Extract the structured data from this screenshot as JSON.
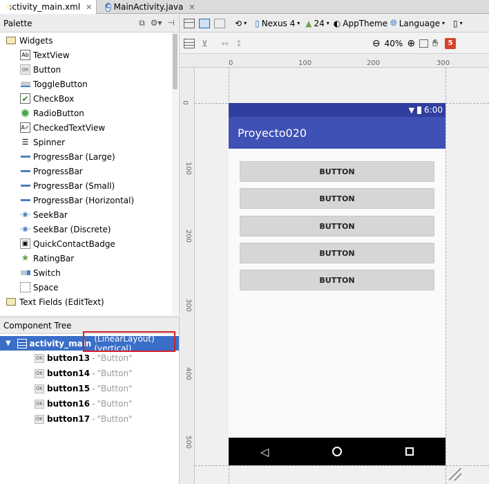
{
  "tabs": [
    {
      "label": "activity_main.xml",
      "icon": "xml-layout-icon",
      "active": true
    },
    {
      "label": "MainActivity.java",
      "icon": "java-class-icon",
      "active": false
    }
  ],
  "palette": {
    "title": "Palette",
    "items": [
      {
        "label": "Widgets",
        "kind": "folder"
      },
      {
        "label": "TextView",
        "icon": "Ab"
      },
      {
        "label": "Button",
        "icon": "OK"
      },
      {
        "label": "ToggleButton",
        "icon": "toggle"
      },
      {
        "label": "CheckBox",
        "icon": "check"
      },
      {
        "label": "RadioButton",
        "icon": "radio"
      },
      {
        "label": "CheckedTextView",
        "icon": "checked-text"
      },
      {
        "label": "Spinner",
        "icon": "spinner"
      },
      {
        "label": "ProgressBar (Large)",
        "icon": "progress"
      },
      {
        "label": "ProgressBar",
        "icon": "progress"
      },
      {
        "label": "ProgressBar (Small)",
        "icon": "progress"
      },
      {
        "label": "ProgressBar (Horizontal)",
        "icon": "progress"
      },
      {
        "label": "SeekBar",
        "icon": "seek"
      },
      {
        "label": "SeekBar (Discrete)",
        "icon": "seek"
      },
      {
        "label": "QuickContactBadge",
        "icon": "badge"
      },
      {
        "label": "RatingBar",
        "icon": "star"
      },
      {
        "label": "Switch",
        "icon": "switch"
      },
      {
        "label": "Space",
        "icon": "space"
      },
      {
        "label": "Text Fields (EditText)",
        "kind": "folder"
      }
    ]
  },
  "component_tree": {
    "title": "Component Tree",
    "root": {
      "name": "activity_main",
      "detail": "(LinearLayout) (vertical)"
    },
    "children": [
      {
        "name": "button13",
        "sep": "-",
        "text": "\"Button\""
      },
      {
        "name": "button14",
        "sep": "-",
        "text": "\"Button\""
      },
      {
        "name": "button15",
        "sep": "-",
        "text": "\"Button\""
      },
      {
        "name": "button16",
        "sep": "-",
        "text": "\"Button\""
      },
      {
        "name": "button17",
        "sep": "-",
        "text": "\"Button\""
      }
    ]
  },
  "toolbar": {
    "device": "Nexus 4",
    "api": "24",
    "theme": "AppTheme",
    "language": "Language",
    "zoom": "40%",
    "warnings": "5"
  },
  "ruler": {
    "h": [
      "0",
      "100",
      "200",
      "300"
    ],
    "v": [
      "0",
      "100",
      "200",
      "300",
      "400",
      "500"
    ]
  },
  "device": {
    "time": "6:00",
    "app_title": "Proyecto020",
    "buttons": [
      "BUTTON",
      "BUTTON",
      "BUTTON",
      "BUTTON",
      "BUTTON"
    ]
  },
  "colors": {
    "status_bar": "#303f9f",
    "app_bar": "#3f51b5",
    "selection": "#3a6ec8",
    "highlight": "#d0202a"
  }
}
